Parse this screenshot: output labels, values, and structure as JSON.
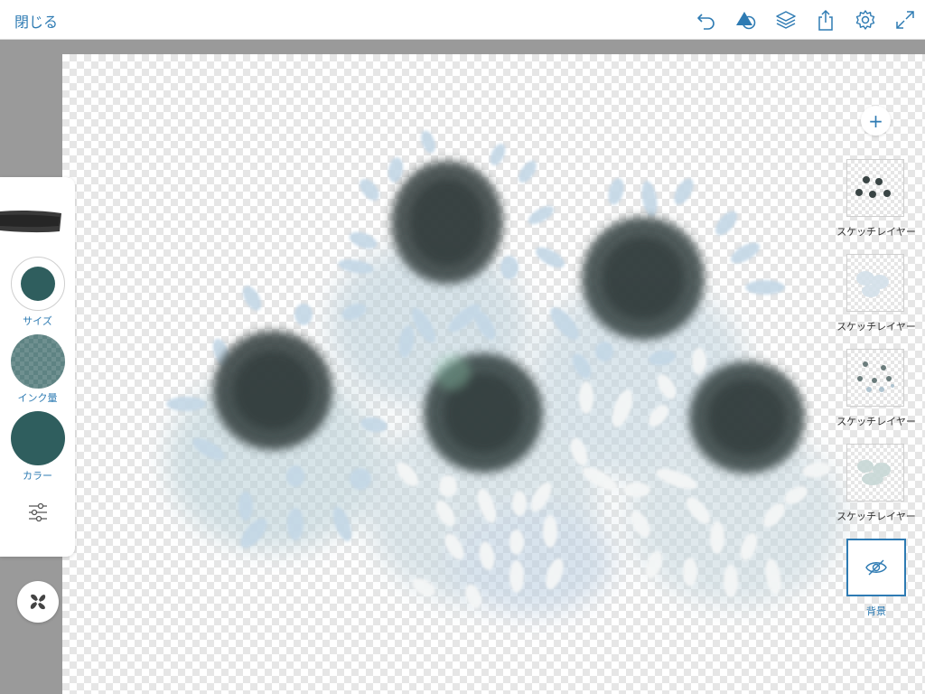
{
  "topbar": {
    "close_label": "閉じる",
    "icons": [
      "undo-icon",
      "shapes-icon",
      "layers-icon",
      "share-icon",
      "gear-icon",
      "expand-icon"
    ]
  },
  "tools": {
    "size_label": "サイズ",
    "ink_label": "インク量",
    "color_label": "カラー",
    "color": "#2f5e5e"
  },
  "layers": {
    "add_label": "+",
    "items": [
      {
        "label": "スケッチレイヤー"
      },
      {
        "label": "スケッチレイヤー"
      },
      {
        "label": "スケッチレイヤー"
      },
      {
        "label": "スケッチレイヤー"
      }
    ],
    "background_label": "背景"
  },
  "colors": {
    "accent": "#2e7bb3",
    "ink_dark": "#3a4747",
    "petal_blue": "#c3d7e6",
    "petal_white": "#f2f4f4"
  }
}
